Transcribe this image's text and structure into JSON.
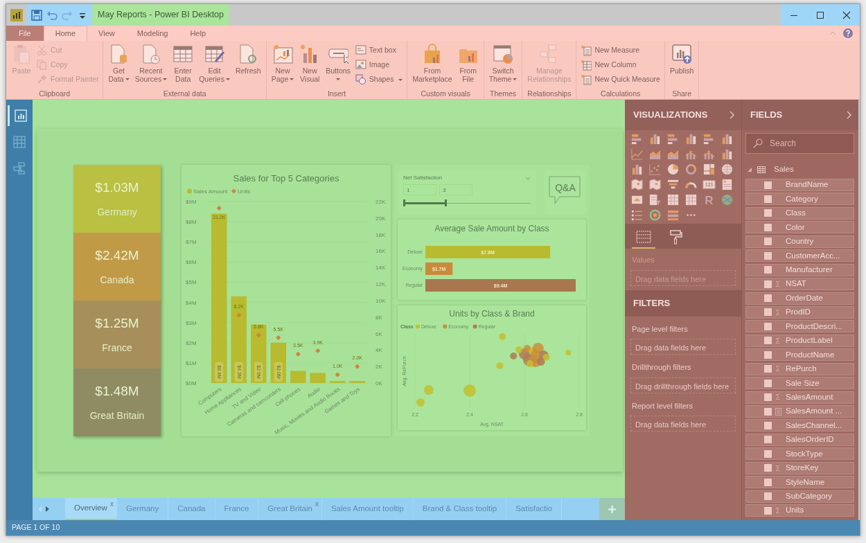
{
  "window": {
    "title": "May Reports - Power BI Desktop"
  },
  "menu_tabs": [
    {
      "label": "File",
      "kind": "file",
      "selected": false
    },
    {
      "label": "Home",
      "kind": "tab",
      "selected": true
    },
    {
      "label": "View",
      "kind": "tab",
      "selected": false
    },
    {
      "label": "Modeling",
      "kind": "tab",
      "selected": false
    },
    {
      "label": "Help",
      "kind": "tab",
      "selected": false
    }
  ],
  "ribbon": [
    {
      "label": "Clipboard",
      "items": [
        {
          "label": "Paste",
          "kind": "large",
          "disabled": true,
          "dropdown": false
        },
        {
          "label": "Cut",
          "kind": "small",
          "disabled": true,
          "dropdown": false
        },
        {
          "label": "Copy",
          "kind": "small",
          "disabled": true,
          "dropdown": false
        },
        {
          "label": "Format Painter",
          "kind": "small",
          "disabled": true,
          "dropdown": false
        }
      ]
    },
    {
      "label": "External data",
      "items": [
        {
          "label": "Get Data",
          "kind": "large",
          "disabled": false,
          "dropdown": true
        },
        {
          "label": "Recent Sources",
          "kind": "large",
          "disabled": false,
          "dropdown": true
        },
        {
          "label": "Enter Data",
          "kind": "large",
          "disabled": false,
          "dropdown": false
        },
        {
          "label": "Edit Queries",
          "kind": "large",
          "disabled": false,
          "dropdown": true
        },
        {
          "label": "Refresh",
          "kind": "large",
          "disabled": false,
          "dropdown": false
        }
      ]
    },
    {
      "label": "Insert",
      "items": [
        {
          "label": "New Page",
          "kind": "large",
          "disabled": false,
          "dropdown": true
        },
        {
          "label": "New Visual",
          "kind": "large",
          "disabled": false,
          "dropdown": false
        },
        {
          "label": "Buttons",
          "kind": "large",
          "disabled": false,
          "dropdown": true
        },
        {
          "label": "Text box",
          "kind": "small",
          "disabled": false,
          "dropdown": false
        },
        {
          "label": "Image",
          "kind": "small",
          "disabled": false,
          "dropdown": false
        },
        {
          "label": "Shapes",
          "kind": "small",
          "disabled": false,
          "dropdown": true
        }
      ]
    },
    {
      "label": "Custom visuals",
      "items": [
        {
          "label": "From Marketplace",
          "kind": "large",
          "disabled": false,
          "dropdown": false
        },
        {
          "label": "From File",
          "kind": "large",
          "disabled": false,
          "dropdown": false
        }
      ]
    },
    {
      "label": "Themes",
      "items": [
        {
          "label": "Switch Theme",
          "kind": "large",
          "disabled": false,
          "dropdown": true
        }
      ]
    },
    {
      "label": "Relationships",
      "items": [
        {
          "label": "Manage Relationships",
          "kind": "large",
          "disabled": true,
          "dropdown": false
        }
      ]
    },
    {
      "label": "Calculations",
      "items": [
        {
          "label": "New Measure",
          "kind": "small",
          "disabled": false,
          "dropdown": false
        },
        {
          "label": "New Column",
          "kind": "small",
          "disabled": false,
          "dropdown": false
        },
        {
          "label": "New Quick Measure",
          "kind": "small",
          "disabled": false,
          "dropdown": false
        }
      ]
    },
    {
      "label": "Share",
      "items": [
        {
          "label": "Publish",
          "kind": "large",
          "disabled": false,
          "dropdown": false
        }
      ]
    }
  ],
  "left_nav": [
    {
      "kind": "report",
      "selected": true
    },
    {
      "kind": "data",
      "selected": false
    },
    {
      "kind": "model",
      "selected": false
    }
  ],
  "cards": [
    {
      "value": "$1.03M",
      "label": "Germany",
      "color": "#b9c042"
    },
    {
      "value": "$2.42M",
      "label": "Canada",
      "color": "#c19a47"
    },
    {
      "value": "$1.25M",
      "label": "France",
      "color": "#a68f5a"
    },
    {
      "value": "$1.48M",
      "label": "Great Britain",
      "color": "#8f8b62"
    }
  ],
  "sales_chart": {
    "chart_data": {
      "type": "bar",
      "title": "Sales for Top 5 Categories",
      "categories": [
        "Computers",
        "Home Appliances",
        "TV and Video",
        "Cameras and camcorders",
        "Cell phones",
        "Audio",
        "Music, Movies and Audio Books",
        "Games and Toys"
      ],
      "series": [
        {
          "name": "Sales Amount",
          "color": "#b8bb2f",
          "type": "bar",
          "axis": "y",
          "values": [
            8.4,
            4.3,
            2.9,
            2.0,
            0.6,
            0.5,
            0.1,
            0.1
          ]
        },
        {
          "name": "Units",
          "color": "#d2813a",
          "type": "scatter",
          "axis": "y2",
          "values": [
            21.2,
            8.2,
            5.8,
            5.5,
            3.5,
            3.9,
            1.0,
            2.0
          ]
        }
      ],
      "grid": true,
      "legend": true,
      "value_labels": [
        [
          "$8.4M",
          "$4.3M",
          "$2.9M",
          "$2.0M",
          null,
          null,
          null,
          null
        ],
        [
          "21.2K",
          "8.2K",
          "5.8K",
          "5.5K",
          "3.5K",
          "3.9K",
          "1.0K",
          "2.0K"
        ]
      ],
      "ylim": [
        0,
        9
      ],
      "yticks": [
        {
          "value": 0,
          "label": "$0M"
        },
        {
          "value": 1,
          "label": "$1M"
        },
        {
          "value": 2,
          "label": "$2M"
        },
        {
          "value": 3,
          "label": "$3M"
        },
        {
          "value": 4,
          "label": "$4M"
        },
        {
          "value": 5,
          "label": "$5M"
        },
        {
          "value": 6,
          "label": "$6M"
        },
        {
          "value": 7,
          "label": "$7M"
        },
        {
          "value": 8,
          "label": "$8M"
        },
        {
          "value": 9,
          "label": "$9M"
        }
      ],
      "y2lim": [
        0,
        22
      ],
      "y2ticks": [
        {
          "value": 0,
          "label": "0K"
        },
        {
          "value": 2,
          "label": "2K"
        },
        {
          "value": 4,
          "label": "4K"
        },
        {
          "value": 6,
          "label": "6K"
        },
        {
          "value": 8,
          "label": "8K"
        },
        {
          "value": 10,
          "label": "10K"
        },
        {
          "value": 12,
          "label": "12K"
        },
        {
          "value": 14,
          "label": "14K"
        },
        {
          "value": 16,
          "label": "16K"
        },
        {
          "value": 18,
          "label": "18K"
        },
        {
          "value": 20,
          "label": "20K"
        },
        {
          "value": 22,
          "label": "22K"
        }
      ]
    }
  },
  "slicer": {
    "title": "Net Satisfaction",
    "min": "1",
    "max": "3",
    "level": 0.33
  },
  "qa_button": {
    "label": "Q&A"
  },
  "class_chart": {
    "chart_data": {
      "type": "bar",
      "orientation": "horizontal",
      "title": "Average Sale Amount by Class",
      "categories": [
        "Deluxe",
        "Economy",
        "Regular"
      ],
      "values": [
        7.8,
        1.7,
        9.4
      ],
      "colors": [
        "#b8bb2f",
        "#c98b3b",
        "#a8774f"
      ],
      "value_labels": [
        "$7.8M",
        "$1.7M",
        "$9.4M"
      ]
    }
  },
  "bubble_chart": {
    "title": "Units by Class & Brand",
    "legend_title": "Class",
    "legend": [
      {
        "label": "Deluxe",
        "color": "#c4bf2e"
      },
      {
        "label": "Economy",
        "color": "#cc8e37"
      },
      {
        "label": "Regular",
        "color": "#b07a55"
      }
    ],
    "xticks": [
      "2.2",
      "2.4",
      "2.6",
      "2.8"
    ],
    "xlabel": "Avg. NSAT",
    "ylabel": "Avg. RePurch"
  },
  "page_tabs": [
    {
      "label": "Overview",
      "selected": true,
      "close": "x"
    },
    {
      "label": "Germany",
      "selected": false
    },
    {
      "label": "Canada",
      "selected": false
    },
    {
      "label": "France",
      "selected": false
    },
    {
      "label": "Great Britain",
      "selected": false,
      "close": "x"
    },
    {
      "label": "Sales Amount tooltip",
      "selected": false
    },
    {
      "label": "Brand & Class tooltip",
      "selected": false
    },
    {
      "label": "Satisfactio",
      "selected": false
    }
  ],
  "status_bar": "PAGE 1 OF 10",
  "visualizations": {
    "title": "VISUALIZATIONS",
    "card_icon_text": "123",
    "r_icon_text": "R",
    "pane_tabs": [
      {
        "kind": "fields",
        "selected": true
      },
      {
        "kind": "format",
        "selected": false
      }
    ],
    "values_label": "Values",
    "values_placeholder": "Drag data fields here"
  },
  "filters": {
    "title": "FILTERS",
    "sections": [
      {
        "label": "Page level filters",
        "placeholder": "Drag data fields here"
      },
      {
        "label": "Drillthrough filters",
        "placeholder": "Drag drillthrough fields here"
      },
      {
        "label": "Report level filters",
        "placeholder": "Drag data fields here"
      }
    ]
  },
  "fields": {
    "title": "FIELDS",
    "search": {
      "placeholder": "Search"
    },
    "table": {
      "name": "Sales",
      "expanded": true,
      "children": [
        {
          "name": "BrandName",
          "kind": "column",
          "checked": false
        },
        {
          "name": "Category",
          "kind": "column",
          "checked": false
        },
        {
          "name": "Class",
          "kind": "column",
          "checked": false
        },
        {
          "name": "Color",
          "kind": "column",
          "checked": false
        },
        {
          "name": "Country",
          "kind": "column",
          "checked": false
        },
        {
          "name": "CustomerAcc...",
          "kind": "column",
          "checked": false
        },
        {
          "name": "Manufacturer",
          "kind": "column",
          "checked": false
        },
        {
          "name": "NSAT",
          "kind": "sum",
          "symbol": "Σ",
          "checked": false
        },
        {
          "name": "OrderDate",
          "kind": "column",
          "checked": false
        },
        {
          "name": "ProdID",
          "kind": "sum",
          "symbol": "Σ",
          "checked": false
        },
        {
          "name": "ProductDescri...",
          "kind": "column",
          "checked": false
        },
        {
          "name": "ProductLabel",
          "kind": "sum",
          "symbol": "Σ",
          "checked": false
        },
        {
          "name": "ProductName",
          "kind": "column",
          "checked": false
        },
        {
          "name": "RePurch",
          "kind": "sum",
          "symbol": "Σ",
          "checked": false
        },
        {
          "name": "Sale Size",
          "kind": "column",
          "checked": false
        },
        {
          "name": "SalesAmount",
          "kind": "sum",
          "symbol": "Σ",
          "checked": false
        },
        {
          "name": "SalesAmount ...",
          "kind": "measure",
          "checked": false
        },
        {
          "name": "SalesChannel...",
          "kind": "column",
          "checked": false
        },
        {
          "name": "SalesOrderID",
          "kind": "column",
          "checked": false
        },
        {
          "name": "StockType",
          "kind": "column",
          "checked": false
        },
        {
          "name": "StoreKey",
          "kind": "sum",
          "symbol": "Σ",
          "checked": false
        },
        {
          "name": "StyleName",
          "kind": "column",
          "checked": false
        },
        {
          "name": "SubCategory",
          "kind": "column",
          "checked": false
        },
        {
          "name": "Units",
          "kind": "sum",
          "symbol": "Σ",
          "checked": false
        }
      ]
    }
  }
}
